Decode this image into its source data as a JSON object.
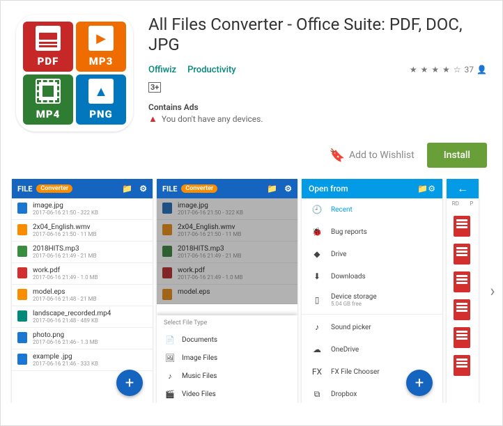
{
  "app": {
    "title": "All Files Converter - Office Suite: PDF, DOC, JPG",
    "developer": "Offiwiz",
    "category": "Productivity",
    "rating_count": "37",
    "age_rating": "3+",
    "contains_ads": "Contains Ads",
    "device_warning": "You don't have any devices.",
    "wishlist_label": "Add to Wishlist",
    "install_label": "Install"
  },
  "icon": {
    "pdf": "PDF",
    "mp3": "MP3",
    "mp4": "MP4",
    "png": "PNG"
  },
  "shot1": {
    "brand": "FILE",
    "badge": "Converter",
    "files": [
      {
        "name": "image.jpg",
        "meta": "2017-06-16 21:50 - 322 KB",
        "c": "blue"
      },
      {
        "name": "2x04_English.wmv",
        "meta": "2017-06-16 21:50 - 11 MB",
        "c": "orange"
      },
      {
        "name": "2018HITS.mp3",
        "meta": "2017-06-16 21:49 - 21 MB",
        "c": "green"
      },
      {
        "name": "work.pdf",
        "meta": "2017-06-16 21:49 - 1.0 MB",
        "c": "red"
      },
      {
        "name": "model.eps",
        "meta": "2017-06-16 21:48 - 21 MB",
        "c": "orange"
      },
      {
        "name": "landscape_recorded.mp4",
        "meta": "2017-06-16 21:48 - 489 KB",
        "c": "teal"
      },
      {
        "name": "photo.png",
        "meta": "2017-06-16 21:46 - 1.3 MB",
        "c": "blue"
      },
      {
        "name": "example .jpg",
        "meta": "2017-06-16 21:46 - 333 KB",
        "c": "blue"
      }
    ]
  },
  "shot2": {
    "brand": "FILE",
    "badge": "Converter",
    "files": [
      {
        "name": "image.jpg",
        "meta": "2017-06-16 21:50 - 322 KB",
        "c": "blue"
      },
      {
        "name": "2x04_English.wmv",
        "meta": "2017-06-16 21:50 - 11 MB",
        "c": "orange"
      },
      {
        "name": "2018HITS.mp3",
        "meta": "2017-06-16 21:49 - 21 MB",
        "c": "green"
      },
      {
        "name": "work.pdf",
        "meta": "2017-06-16 21:49 - 1.0 MB",
        "c": "red"
      },
      {
        "name": "model.eps",
        "meta": "",
        "c": "orange"
      }
    ],
    "sheet_title": "Select File Type",
    "sheet_items": [
      "Documents",
      "Image Files",
      "Music Files",
      "Video Files"
    ]
  },
  "shot3": {
    "title": "Open from",
    "items": [
      {
        "label": "Recent",
        "sub": "",
        "ico": "🕘",
        "active": true
      },
      {
        "label": "Bug reports",
        "sub": "",
        "ico": "🐞"
      },
      {
        "label": "Drive",
        "sub": "",
        "ico": "◆"
      },
      {
        "label": "Downloads",
        "sub": "",
        "ico": "⬇"
      },
      {
        "label": "Device storage",
        "sub": "5.04 GB free",
        "ico": "▯"
      },
      {
        "sep": true
      },
      {
        "label": "Sound picker",
        "sub": "",
        "ico": "♪"
      },
      {
        "label": "OneDrive",
        "sub": "",
        "ico": "☁"
      },
      {
        "label": "FX File Chooser",
        "sub": "",
        "ico": "FX"
      },
      {
        "label": "Dropbox",
        "sub": "",
        "ico": "⧉"
      }
    ]
  },
  "shot4": {
    "tabs": [
      "RD",
      "P"
    ]
  }
}
